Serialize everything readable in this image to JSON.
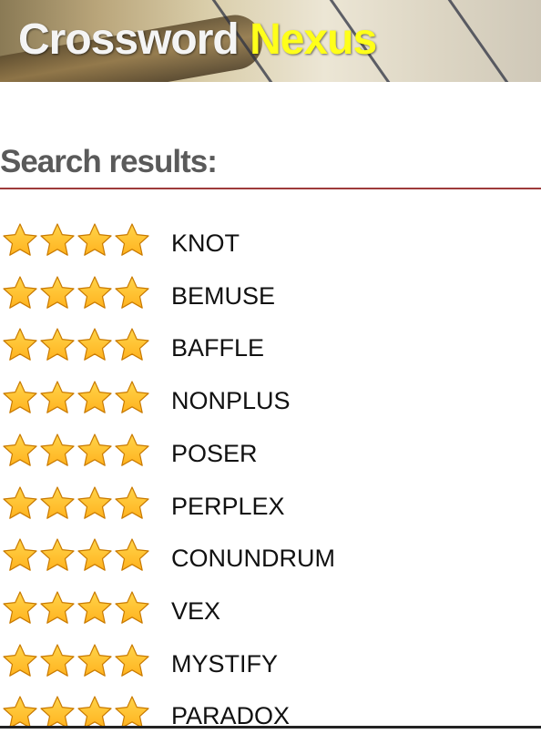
{
  "header": {
    "brand_part1": "Crossword",
    "brand_part2": "Nexus",
    "brand_color_1": "#f4f4f4",
    "brand_color_2": "#ffff1a"
  },
  "section": {
    "title": "Search results:"
  },
  "results": [
    {
      "word": "KNOT",
      "rating": 4
    },
    {
      "word": "BEMUSE",
      "rating": 4
    },
    {
      "word": "BAFFLE",
      "rating": 4
    },
    {
      "word": "NONPLUS",
      "rating": 4
    },
    {
      "word": "POSER",
      "rating": 4
    },
    {
      "word": "PERPLEX",
      "rating": 4
    },
    {
      "word": "CONUNDRUM",
      "rating": 4
    },
    {
      "word": "VEX",
      "rating": 4
    },
    {
      "word": "MYSTIFY",
      "rating": 4
    },
    {
      "word": "PARADOX",
      "rating": 4
    }
  ],
  "colors": {
    "star_fill": "#ffb21f",
    "divider": "#9e3a3a"
  },
  "icons": {
    "rating": "star-icon"
  }
}
